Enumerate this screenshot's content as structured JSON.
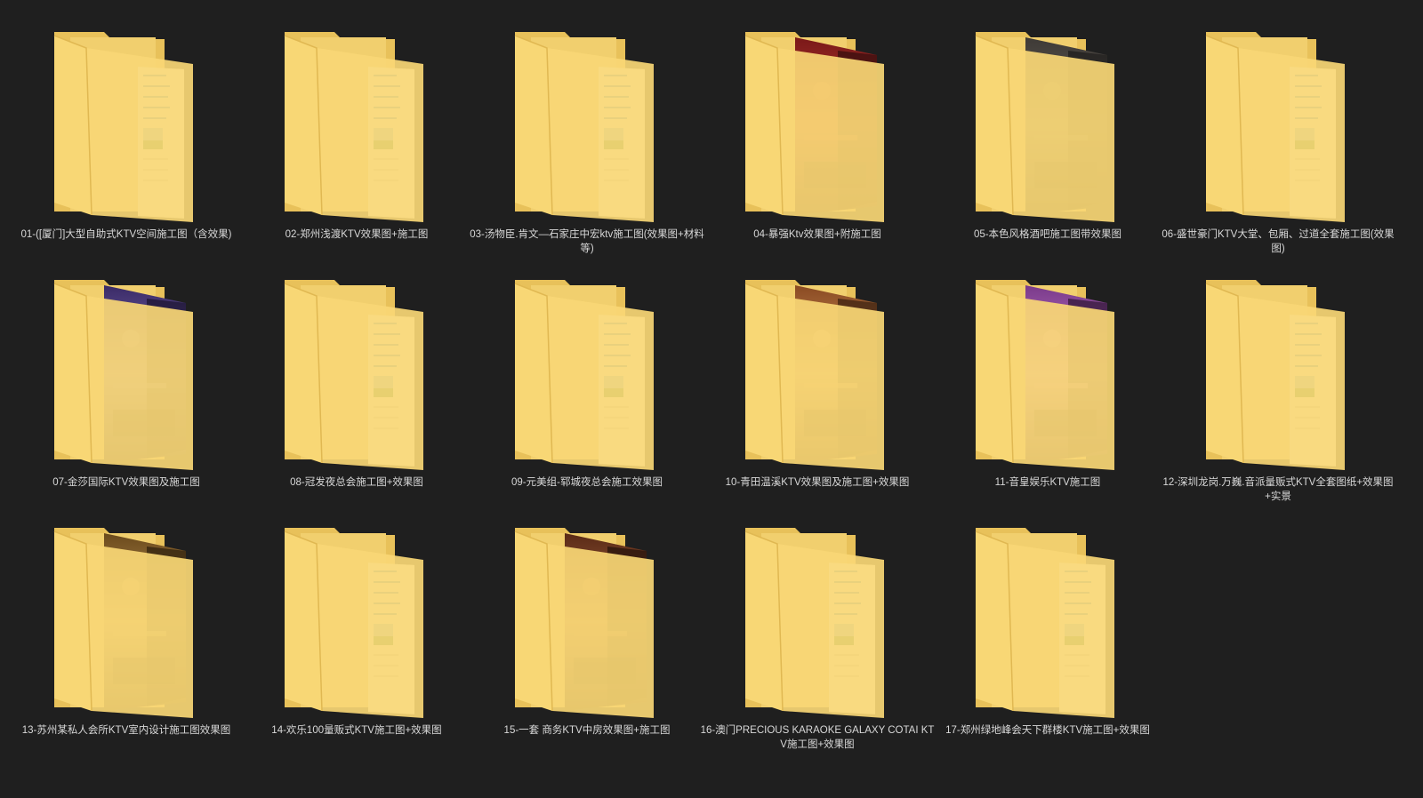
{
  "window": {
    "view": "large-icons",
    "background": "#1f1f1f"
  },
  "folders": [
    {
      "name": "01-([厦门]大型自助式KTV空间施工图（含效果)",
      "icon": "folder-document-icon",
      "preview": "document"
    },
    {
      "name": "02-郑州浅渡KTV效果图+施工图",
      "icon": "folder-document-icon",
      "preview": "document"
    },
    {
      "name": "03-汤物臣.肯文—石家庄中宏ktv施工图(效果图+材料等)",
      "icon": "folder-document-icon",
      "preview": "document"
    },
    {
      "name": "04-暴强Ktv效果图+附施工图",
      "icon": "folder-photo-icon",
      "preview": "photo-red"
    },
    {
      "name": "05-本色风格酒吧施工图带效果图",
      "icon": "folder-photo-icon",
      "preview": "photo-gray"
    },
    {
      "name": "06-盛世豪门KTV大堂、包厢、过道全套施工图(效果图)",
      "icon": "folder-document-icon",
      "preview": "document"
    },
    {
      "name": "07-金莎国际KTV效果图及施工图",
      "icon": "folder-photo-icon",
      "preview": "photo-purple"
    },
    {
      "name": "08-冠发夜总会施工图+效果图",
      "icon": "folder-document-icon",
      "preview": "document"
    },
    {
      "name": "09-元美组-郓城夜总会施工效果图",
      "icon": "folder-document-icon",
      "preview": "document"
    },
    {
      "name": "10-青田温溪KTV效果图及施工图+效果图",
      "icon": "folder-photo-icon",
      "preview": "photo-warm"
    },
    {
      "name": "11-音皇娱乐KTV施工图",
      "icon": "folder-photo-icon",
      "preview": "photo-violet"
    },
    {
      "name": "12-深圳龙岗.万巍.音派量贩式KTV全套图纸+效果图+实景",
      "icon": "folder-document-icon",
      "preview": "document"
    },
    {
      "name": "13-苏州某私人会所KTV室内设计施工图效果图",
      "icon": "folder-photo-icon",
      "preview": "photo-gold"
    },
    {
      "name": "14-欢乐100量贩式KTV施工图+效果图",
      "icon": "folder-document-icon",
      "preview": "document"
    },
    {
      "name": "15-一套 商务KTV中房效果图+施工图",
      "icon": "folder-photo-icon",
      "preview": "photo-brown"
    },
    {
      "name": "16-澳门PRECIOUS KARAOKE GALAXY COTAI KTV施工图+效果图",
      "icon": "folder-document-icon",
      "preview": "document"
    },
    {
      "name": "17-郑州绿地峰会天下群楼KTV施工图+效果图",
      "icon": "folder-document-icon",
      "preview": "document"
    }
  ],
  "colors": {
    "folder_back": "#e8c15a",
    "folder_front": "#f8d775",
    "label_text": "#d8d8d8"
  }
}
